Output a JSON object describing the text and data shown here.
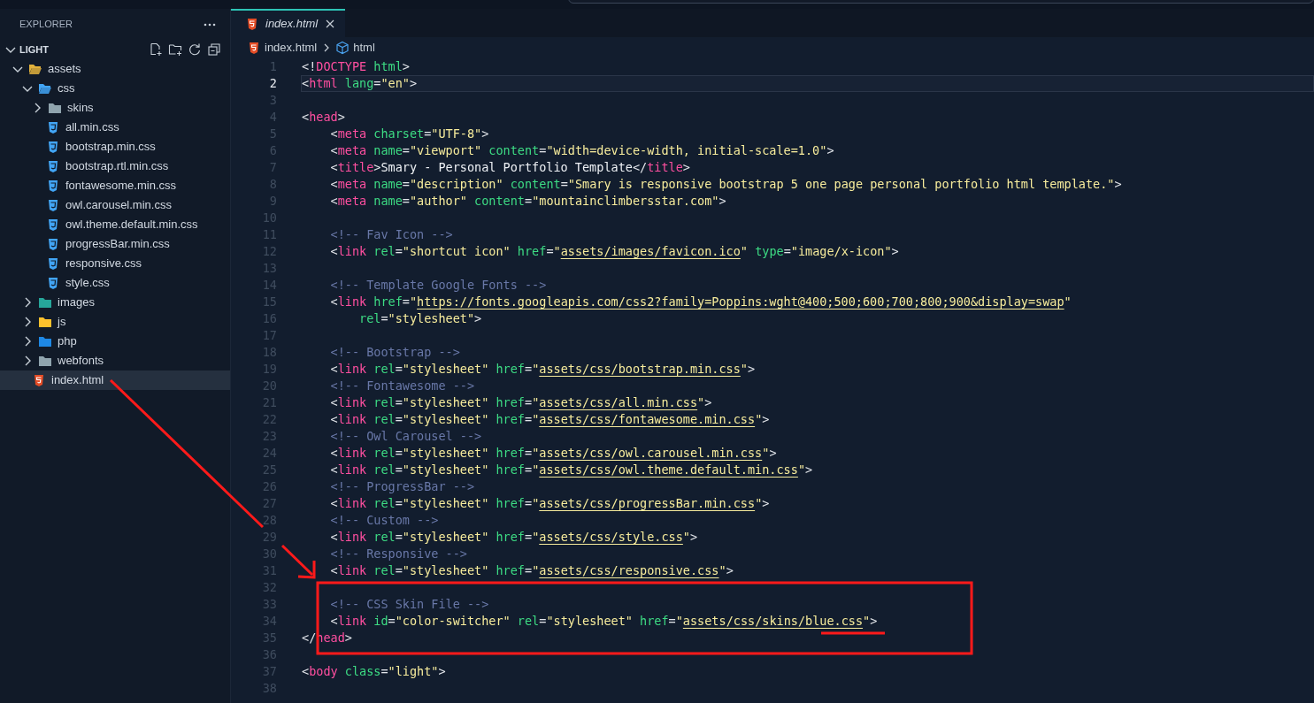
{
  "explorer": {
    "title": "EXPLORER",
    "root": {
      "label": "LIGHT",
      "expanded": true,
      "children": [
        {
          "label": "assets",
          "kind": "folder",
          "color": "#e2b23c",
          "expanded": true,
          "selected": false,
          "children": [
            {
              "label": "css",
              "kind": "folder",
              "color": "#42a5f5",
              "expanded": true,
              "selected": false,
              "children": [
                {
                  "label": "skins",
                  "kind": "folder",
                  "color": "#90a4ae",
                  "expanded": false,
                  "selected": false
                },
                {
                  "label": "all.min.css",
                  "kind": "css",
                  "selected": false
                },
                {
                  "label": "bootstrap.min.css",
                  "kind": "css",
                  "selected": false
                },
                {
                  "label": "bootstrap.rtl.min.css",
                  "kind": "css",
                  "selected": false
                },
                {
                  "label": "fontawesome.min.css",
                  "kind": "css",
                  "selected": false
                },
                {
                  "label": "owl.carousel.min.css",
                  "kind": "css",
                  "selected": false
                },
                {
                  "label": "owl.theme.default.min.css",
                  "kind": "css",
                  "selected": false
                },
                {
                  "label": "progressBar.min.css",
                  "kind": "css",
                  "selected": false
                },
                {
                  "label": "responsive.css",
                  "kind": "css",
                  "selected": false
                },
                {
                  "label": "style.css",
                  "kind": "css",
                  "selected": false
                }
              ]
            },
            {
              "label": "images",
              "kind": "folder",
              "color": "#26a69a",
              "expanded": false,
              "selected": false
            },
            {
              "label": "js",
              "kind": "folder",
              "color": "#fbc02d",
              "expanded": false,
              "selected": false
            },
            {
              "label": "php",
              "kind": "folder",
              "color": "#1e88e5",
              "expanded": false,
              "selected": false
            },
            {
              "label": "webfonts",
              "kind": "folder",
              "color": "#90a4ae",
              "expanded": false,
              "selected": false
            }
          ]
        },
        {
          "label": "index.html",
          "kind": "html",
          "selected": true
        }
      ]
    }
  },
  "tabs": [
    {
      "label": "index.html",
      "selected": true,
      "preview": true
    }
  ],
  "breadcrumb": [
    {
      "label": "index.html",
      "kind": "file"
    },
    {
      "label": "html",
      "kind": "element"
    }
  ],
  "code_lines": [
    {
      "number": "1",
      "current": false,
      "tokens": [
        {
          "kind": "punct",
          "text": "<!"
        },
        {
          "kind": "tag",
          "text": "DOCTYPE"
        },
        {
          "kind": "attr",
          "text": " html"
        },
        {
          "kind": "punct",
          "text": ">"
        }
      ]
    },
    {
      "number": "2",
      "current": true,
      "tokens": [
        {
          "kind": "punct",
          "text": "<"
        },
        {
          "kind": "tag",
          "text": "html"
        },
        {
          "kind": "attr",
          "text": " lang"
        },
        {
          "kind": "punct",
          "text": "="
        },
        {
          "kind": "string",
          "text": "\"en\""
        },
        {
          "kind": "punct",
          "text": ">"
        }
      ]
    },
    {
      "number": "3",
      "current": false
    },
    {
      "number": "4",
      "current": false,
      "tokens": [
        {
          "kind": "punct",
          "text": "<"
        },
        {
          "kind": "tag",
          "text": "head"
        },
        {
          "kind": "punct",
          "text": ">"
        }
      ]
    },
    {
      "number": "5",
      "current": false,
      "tokens": [
        {
          "kind": "punct",
          "text": "    <"
        },
        {
          "kind": "tag",
          "text": "meta"
        },
        {
          "kind": "attr",
          "text": " charset"
        },
        {
          "kind": "punct",
          "text": "="
        },
        {
          "kind": "string",
          "text": "\"UTF-8\""
        },
        {
          "kind": "punct",
          "text": ">"
        }
      ]
    },
    {
      "number": "6",
      "current": false,
      "tokens": [
        {
          "kind": "punct",
          "text": "    <"
        },
        {
          "kind": "tag",
          "text": "meta"
        },
        {
          "kind": "attr",
          "text": " name"
        },
        {
          "kind": "punct",
          "text": "="
        },
        {
          "kind": "string",
          "text": "\"viewport\""
        },
        {
          "kind": "attr",
          "text": " content"
        },
        {
          "kind": "punct",
          "text": "="
        },
        {
          "kind": "string",
          "text": "\"width=device-width, initial-scale=1.0\""
        },
        {
          "kind": "punct",
          "text": ">"
        }
      ]
    },
    {
      "number": "7",
      "current": false,
      "tokens": [
        {
          "kind": "punct",
          "text": "    <"
        },
        {
          "kind": "tag",
          "text": "title"
        },
        {
          "kind": "punct",
          "text": ">"
        },
        {
          "kind": "text",
          "text": "Smary - Personal Portfolio Template"
        },
        {
          "kind": "punct",
          "text": "</"
        },
        {
          "kind": "tag",
          "text": "title"
        },
        {
          "kind": "punct",
          "text": ">"
        }
      ]
    },
    {
      "number": "8",
      "current": false,
      "tokens": [
        {
          "kind": "punct",
          "text": "    <"
        },
        {
          "kind": "tag",
          "text": "meta"
        },
        {
          "kind": "attr",
          "text": " name"
        },
        {
          "kind": "punct",
          "text": "="
        },
        {
          "kind": "string",
          "text": "\"description\""
        },
        {
          "kind": "attr",
          "text": " content"
        },
        {
          "kind": "punct",
          "text": "="
        },
        {
          "kind": "string",
          "text": "\"Smary is responsive bootstrap 5 one page personal portfolio html template.\""
        },
        {
          "kind": "punct",
          "text": ">"
        }
      ]
    },
    {
      "number": "9",
      "current": false,
      "tokens": [
        {
          "kind": "punct",
          "text": "    <"
        },
        {
          "kind": "tag",
          "text": "meta"
        },
        {
          "kind": "attr",
          "text": " name"
        },
        {
          "kind": "punct",
          "text": "="
        },
        {
          "kind": "string",
          "text": "\"author\""
        },
        {
          "kind": "attr",
          "text": " content"
        },
        {
          "kind": "punct",
          "text": "="
        },
        {
          "kind": "string",
          "text": "\"mountainclimbersstar.com\""
        },
        {
          "kind": "punct",
          "text": ">"
        }
      ]
    },
    {
      "number": "10",
      "current": false
    },
    {
      "number": "11",
      "current": false,
      "tokens": [
        {
          "kind": "comment",
          "text": "    <!-- Fav Icon -->"
        }
      ]
    },
    {
      "number": "12",
      "current": false,
      "tokens": [
        {
          "kind": "punct",
          "text": "    <"
        },
        {
          "kind": "tag",
          "text": "link"
        },
        {
          "kind": "attr",
          "text": " rel"
        },
        {
          "kind": "punct",
          "text": "="
        },
        {
          "kind": "string",
          "text": "\"shortcut icon\""
        },
        {
          "kind": "attr",
          "text": " href"
        },
        {
          "kind": "punct",
          "text": "="
        },
        {
          "kind": "string",
          "text": "\""
        },
        {
          "kind": "link",
          "text": "assets/images/favicon.ico"
        },
        {
          "kind": "string",
          "text": "\""
        },
        {
          "kind": "attr",
          "text": " type"
        },
        {
          "kind": "punct",
          "text": "="
        },
        {
          "kind": "string",
          "text": "\"image/x-icon\""
        },
        {
          "kind": "punct",
          "text": ">"
        }
      ]
    },
    {
      "number": "13",
      "current": false
    },
    {
      "number": "14",
      "current": false,
      "tokens": [
        {
          "kind": "comment",
          "text": "    <!-- Template Google Fonts -->"
        }
      ]
    },
    {
      "number": "15",
      "current": false,
      "tokens": [
        {
          "kind": "punct",
          "text": "    <"
        },
        {
          "kind": "tag",
          "text": "link"
        },
        {
          "kind": "attr",
          "text": " href"
        },
        {
          "kind": "punct",
          "text": "="
        },
        {
          "kind": "string",
          "text": "\""
        },
        {
          "kind": "link",
          "text": "https://fonts.googleapis.com/css2?family=Poppins:wght@400;500;600;700;800;900&display=swap"
        },
        {
          "kind": "string",
          "text": "\""
        }
      ]
    },
    {
      "number": "16",
      "current": false,
      "tokens": [
        {
          "kind": "attr",
          "text": "        rel"
        },
        {
          "kind": "punct",
          "text": "="
        },
        {
          "kind": "string",
          "text": "\"stylesheet\""
        },
        {
          "kind": "punct",
          "text": ">"
        }
      ]
    },
    {
      "number": "17",
      "current": false
    },
    {
      "number": "18",
      "current": false,
      "tokens": [
        {
          "kind": "comment",
          "text": "    <!-- Bootstrap -->"
        }
      ]
    },
    {
      "number": "19",
      "current": false,
      "tokens": [
        {
          "kind": "punct",
          "text": "    <"
        },
        {
          "kind": "tag",
          "text": "link"
        },
        {
          "kind": "attr",
          "text": " rel"
        },
        {
          "kind": "punct",
          "text": "="
        },
        {
          "kind": "string",
          "text": "\"stylesheet\""
        },
        {
          "kind": "attr",
          "text": " href"
        },
        {
          "kind": "punct",
          "text": "="
        },
        {
          "kind": "string",
          "text": "\""
        },
        {
          "kind": "link",
          "text": "assets/css/bootstrap.min.css"
        },
        {
          "kind": "string",
          "text": "\""
        },
        {
          "kind": "punct",
          "text": ">"
        }
      ]
    },
    {
      "number": "20",
      "current": false,
      "tokens": [
        {
          "kind": "comment",
          "text": "    <!-- Fontawesome -->"
        }
      ]
    },
    {
      "number": "21",
      "current": false,
      "tokens": [
        {
          "kind": "punct",
          "text": "    <"
        },
        {
          "kind": "tag",
          "text": "link"
        },
        {
          "kind": "attr",
          "text": " rel"
        },
        {
          "kind": "punct",
          "text": "="
        },
        {
          "kind": "string",
          "text": "\"stylesheet\""
        },
        {
          "kind": "attr",
          "text": " href"
        },
        {
          "kind": "punct",
          "text": "="
        },
        {
          "kind": "string",
          "text": "\""
        },
        {
          "kind": "link",
          "text": "assets/css/all.min.css"
        },
        {
          "kind": "string",
          "text": "\""
        },
        {
          "kind": "punct",
          "text": ">"
        }
      ]
    },
    {
      "number": "22",
      "current": false,
      "tokens": [
        {
          "kind": "punct",
          "text": "    <"
        },
        {
          "kind": "tag",
          "text": "link"
        },
        {
          "kind": "attr",
          "text": " rel"
        },
        {
          "kind": "punct",
          "text": "="
        },
        {
          "kind": "string",
          "text": "\"stylesheet\""
        },
        {
          "kind": "attr",
          "text": " href"
        },
        {
          "kind": "punct",
          "text": "="
        },
        {
          "kind": "string",
          "text": "\""
        },
        {
          "kind": "link",
          "text": "assets/css/fontawesome.min.css"
        },
        {
          "kind": "string",
          "text": "\""
        },
        {
          "kind": "punct",
          "text": ">"
        }
      ]
    },
    {
      "number": "23",
      "current": false,
      "tokens": [
        {
          "kind": "comment",
          "text": "    <!-- Owl Carousel -->"
        }
      ]
    },
    {
      "number": "24",
      "current": false,
      "tokens": [
        {
          "kind": "punct",
          "text": "    <"
        },
        {
          "kind": "tag",
          "text": "link"
        },
        {
          "kind": "attr",
          "text": " rel"
        },
        {
          "kind": "punct",
          "text": "="
        },
        {
          "kind": "string",
          "text": "\"stylesheet\""
        },
        {
          "kind": "attr",
          "text": " href"
        },
        {
          "kind": "punct",
          "text": "="
        },
        {
          "kind": "string",
          "text": "\""
        },
        {
          "kind": "link",
          "text": "assets/css/owl.carousel.min.css"
        },
        {
          "kind": "string",
          "text": "\""
        },
        {
          "kind": "punct",
          "text": ">"
        }
      ]
    },
    {
      "number": "25",
      "current": false,
      "tokens": [
        {
          "kind": "punct",
          "text": "    <"
        },
        {
          "kind": "tag",
          "text": "link"
        },
        {
          "kind": "attr",
          "text": " rel"
        },
        {
          "kind": "punct",
          "text": "="
        },
        {
          "kind": "string",
          "text": "\"stylesheet\""
        },
        {
          "kind": "attr",
          "text": " href"
        },
        {
          "kind": "punct",
          "text": "="
        },
        {
          "kind": "string",
          "text": "\""
        },
        {
          "kind": "link",
          "text": "assets/css/owl.theme.default.min.css"
        },
        {
          "kind": "string",
          "text": "\""
        },
        {
          "kind": "punct",
          "text": ">"
        }
      ]
    },
    {
      "number": "26",
      "current": false,
      "tokens": [
        {
          "kind": "comment",
          "text": "    <!-- ProgressBar -->"
        }
      ]
    },
    {
      "number": "27",
      "current": false,
      "tokens": [
        {
          "kind": "punct",
          "text": "    <"
        },
        {
          "kind": "tag",
          "text": "link"
        },
        {
          "kind": "attr",
          "text": " rel"
        },
        {
          "kind": "punct",
          "text": "="
        },
        {
          "kind": "string",
          "text": "\"stylesheet\""
        },
        {
          "kind": "attr",
          "text": " href"
        },
        {
          "kind": "punct",
          "text": "="
        },
        {
          "kind": "string",
          "text": "\""
        },
        {
          "kind": "link",
          "text": "assets/css/progressBar.min.css"
        },
        {
          "kind": "string",
          "text": "\""
        },
        {
          "kind": "punct",
          "text": ">"
        }
      ]
    },
    {
      "number": "28",
      "current": false,
      "tokens": [
        {
          "kind": "comment",
          "text": "    <!-- Custom -->"
        }
      ]
    },
    {
      "number": "29",
      "current": false,
      "tokens": [
        {
          "kind": "punct",
          "text": "    <"
        },
        {
          "kind": "tag",
          "text": "link"
        },
        {
          "kind": "attr",
          "text": " rel"
        },
        {
          "kind": "punct",
          "text": "="
        },
        {
          "kind": "string",
          "text": "\"stylesheet\""
        },
        {
          "kind": "attr",
          "text": " href"
        },
        {
          "kind": "punct",
          "text": "="
        },
        {
          "kind": "string",
          "text": "\""
        },
        {
          "kind": "link",
          "text": "assets/css/style.css"
        },
        {
          "kind": "string",
          "text": "\""
        },
        {
          "kind": "punct",
          "text": ">"
        }
      ]
    },
    {
      "number": "30",
      "current": false,
      "tokens": [
        {
          "kind": "comment",
          "text": "    <!-- Responsive -->"
        }
      ]
    },
    {
      "number": "31",
      "current": false,
      "tokens": [
        {
          "kind": "punct",
          "text": "    <"
        },
        {
          "kind": "tag",
          "text": "link"
        },
        {
          "kind": "attr",
          "text": " rel"
        },
        {
          "kind": "punct",
          "text": "="
        },
        {
          "kind": "string",
          "text": "\"stylesheet\""
        },
        {
          "kind": "attr",
          "text": " href"
        },
        {
          "kind": "punct",
          "text": "="
        },
        {
          "kind": "string",
          "text": "\""
        },
        {
          "kind": "link",
          "text": "assets/css/responsive.css"
        },
        {
          "kind": "string",
          "text": "\""
        },
        {
          "kind": "punct",
          "text": ">"
        }
      ]
    },
    {
      "number": "32",
      "current": false
    },
    {
      "number": "33",
      "current": false,
      "tokens": [
        {
          "kind": "comment",
          "text": "    <!-- CSS Skin File -->"
        }
      ]
    },
    {
      "number": "34",
      "current": false,
      "tokens": [
        {
          "kind": "punct",
          "text": "    <"
        },
        {
          "kind": "tag",
          "text": "link"
        },
        {
          "kind": "attr",
          "text": " id"
        },
        {
          "kind": "punct",
          "text": "="
        },
        {
          "kind": "string",
          "text": "\"color-switcher\""
        },
        {
          "kind": "attr",
          "text": " rel"
        },
        {
          "kind": "punct",
          "text": "="
        },
        {
          "kind": "string",
          "text": "\"stylesheet\""
        },
        {
          "kind": "attr",
          "text": " href"
        },
        {
          "kind": "punct",
          "text": "="
        },
        {
          "kind": "string",
          "text": "\""
        },
        {
          "kind": "link",
          "text": "assets/css/skins/blue.css"
        },
        {
          "kind": "string",
          "text": "\""
        },
        {
          "kind": "punct",
          "text": ">"
        }
      ]
    },
    {
      "number": "35",
      "current": false,
      "tokens": [
        {
          "kind": "punct",
          "text": "</"
        },
        {
          "kind": "tag",
          "text": "head"
        },
        {
          "kind": "punct",
          "text": ">"
        }
      ]
    },
    {
      "number": "36",
      "current": false
    },
    {
      "number": "37",
      "current": false,
      "tokens": [
        {
          "kind": "punct",
          "text": "<"
        },
        {
          "kind": "tag",
          "text": "body"
        },
        {
          "kind": "attr",
          "text": " class"
        },
        {
          "kind": "punct",
          "text": "="
        },
        {
          "kind": "string",
          "text": "\"light\""
        },
        {
          "kind": "punct",
          "text": ">"
        }
      ]
    },
    {
      "number": "38",
      "current": false
    }
  ]
}
